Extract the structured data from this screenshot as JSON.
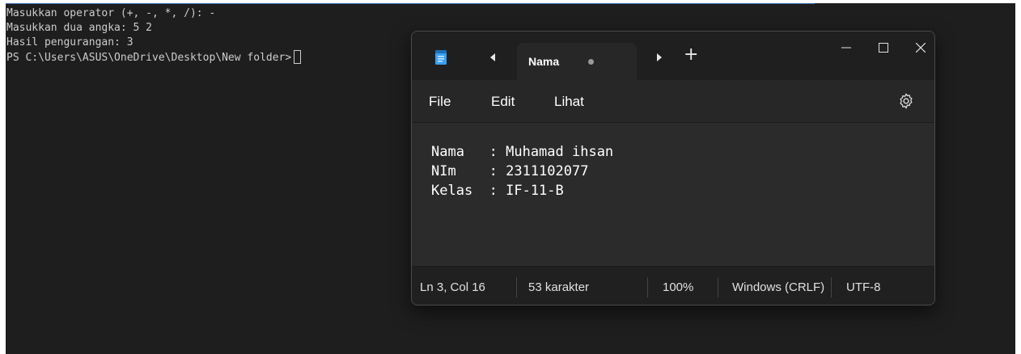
{
  "terminal": {
    "lines": [
      "Masukkan operator (+, -, *, /): -",
      "Masukkan dua angka: 5 2",
      "Hasil pengurangan: 3",
      "PS C:\\Users\\ASUS\\OneDrive\\Desktop\\New folder>"
    ]
  },
  "notepad": {
    "tab_title": "Nama",
    "menu": {
      "file": "File",
      "edit": "Edit",
      "view": "Lihat"
    },
    "content": [
      "Nama   : Muhamad ihsan",
      "NIm    : 2311102077",
      "Kelas  : IF-11-B"
    ],
    "status": {
      "position": "Ln 3, Col 16",
      "chars": "53 karakter",
      "zoom": "100%",
      "line_ending": "Windows (CRLF)",
      "encoding": "UTF-8"
    }
  },
  "colors": {
    "terminal_bg": "#1e1e1e",
    "terminal_text": "#cccccc",
    "notepad_editor_bg": "#2b2b2b",
    "notepad_titlebar_bg": "#1f1f1f",
    "app_icon_accent": "#3aa0f0"
  }
}
